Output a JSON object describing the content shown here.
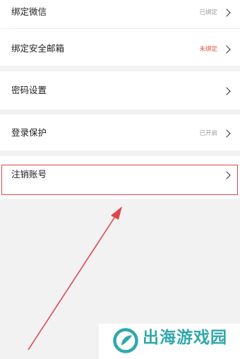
{
  "settings": {
    "bind_wechat": {
      "label": "绑定微信",
      "status": "已绑定",
      "status_color": "#9a9a9a"
    },
    "bind_email": {
      "label": "绑定安全邮箱",
      "status": "未绑定",
      "status_color": "#e0503a"
    },
    "password": {
      "label": "密码设置"
    },
    "login_protect": {
      "label": "登录保护",
      "status": "已开启",
      "status_color": "#9a9a9a"
    },
    "cancel_account": {
      "label": "注销账号"
    }
  },
  "annotation": {
    "highlight_color": "#e0464c"
  },
  "watermark": {
    "text": "出海游戏园",
    "color": "#31a8ab"
  }
}
